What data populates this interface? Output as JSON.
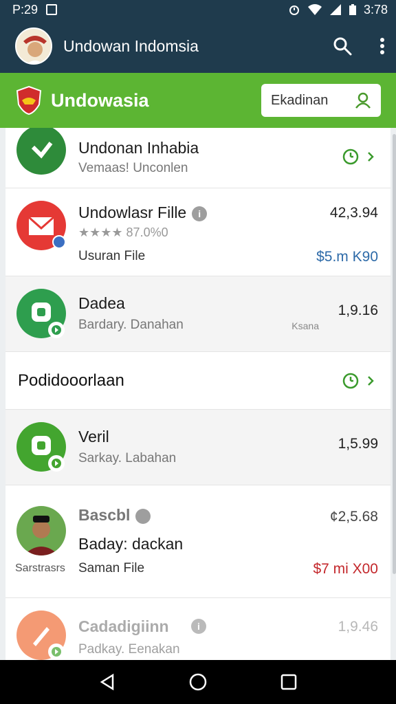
{
  "status_bar": {
    "time_left": "P:29",
    "time_right": "3:78"
  },
  "app_bar": {
    "title": "Undowan Indomsia",
    "icons": [
      "search-icon",
      "more-vert-icon"
    ]
  },
  "header": {
    "brand": "Undowasia",
    "button_label": "Ekadinan"
  },
  "rows": [
    {
      "title": "Undonan Inhabia",
      "subtitle": "Vemaas! Unconlen"
    },
    {
      "title": "Undowlasr Fille",
      "rating": "★★★★ 87.0%0",
      "caption": "Usuran File",
      "value": "42,3.94",
      "price": "$5.m K90"
    },
    {
      "title": "Dadea",
      "subtitle": "Bardary. Danahan",
      "small": "Ksana",
      "value": "1,9.16"
    },
    {
      "section": "Podidooorlaan"
    },
    {
      "title": "Veril",
      "subtitle": "Sarkay. Labahan",
      "value": "1,5.99"
    },
    {
      "title": "Bascbl",
      "subtitle": "Baday: dackan",
      "left_caption": "Sarstrasrs",
      "caption": "Saman File",
      "value": "¢2,5.68",
      "price": "$7 mi X00"
    },
    {
      "title": "Cadadigiinn",
      "subtitle": "Padkay. Eenakan",
      "value": "1,9.46"
    }
  ],
  "colors": {
    "primary": "#1f3b4d",
    "accent_green": "#5cb533",
    "price_blue": "#2d6aa8",
    "price_red": "#c3272b"
  }
}
